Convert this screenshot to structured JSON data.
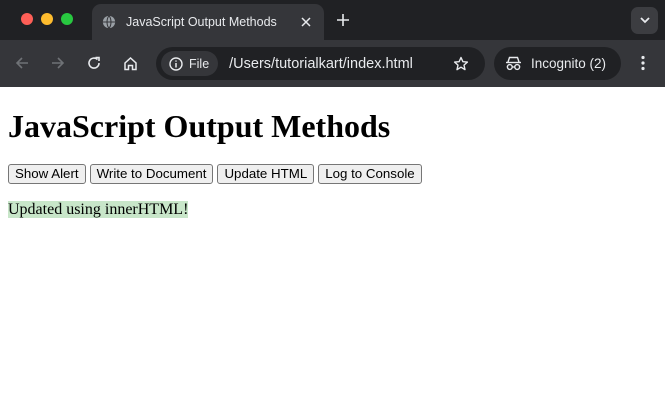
{
  "browser": {
    "tab_title": "JavaScript Output Methods",
    "chip_label": "File",
    "url": "/Users/tutorialkart/index.html",
    "incognito_label": "Incognito (2)"
  },
  "page": {
    "heading": "JavaScript Output Methods",
    "buttons": [
      "Show Alert",
      "Write to Document",
      "Update HTML",
      "Log to Console"
    ],
    "output_text": "Updated using innerHTML!",
    "output_bg": "#c8e6c9"
  }
}
